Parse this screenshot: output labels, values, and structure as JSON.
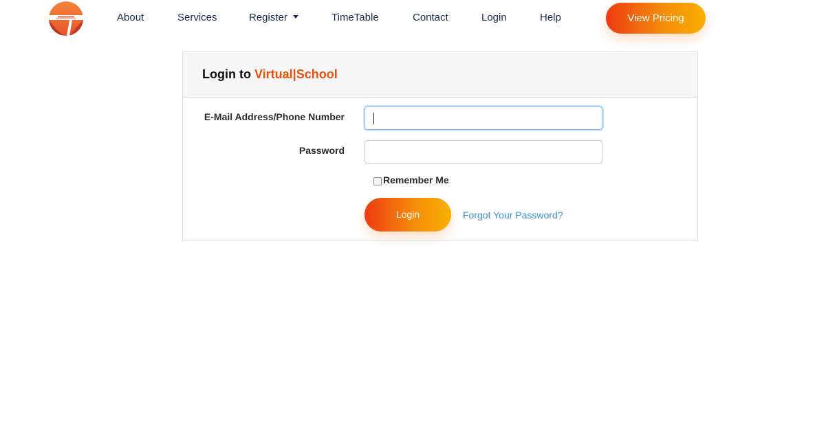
{
  "nav": {
    "logo_icon": "school-globe-logo",
    "items": [
      {
        "label": "About"
      },
      {
        "label": "Services"
      },
      {
        "label": "Register",
        "has_dropdown": true
      },
      {
        "label": "TimeTable"
      },
      {
        "label": "Contact"
      },
      {
        "label": "Login"
      },
      {
        "label": "Help"
      }
    ],
    "cta_label": "View Pricing"
  },
  "login_card": {
    "title_prefix": "Login to ",
    "title_brand": "Virtual|School",
    "email_label": "E-Mail Address/Phone Number",
    "email_value": "",
    "password_label": "Password",
    "password_value": "",
    "remember_label": "Remember Me",
    "remember_checked": false,
    "submit_label": "Login",
    "forgot_label": "Forgot Your Password?"
  },
  "colors": {
    "brand_orange": "#ea4f0c",
    "gradient_start": "#ef3a12",
    "gradient_end": "#f9b000",
    "nav_text": "#1a2b4a",
    "link_blue": "#3a8fd0"
  }
}
